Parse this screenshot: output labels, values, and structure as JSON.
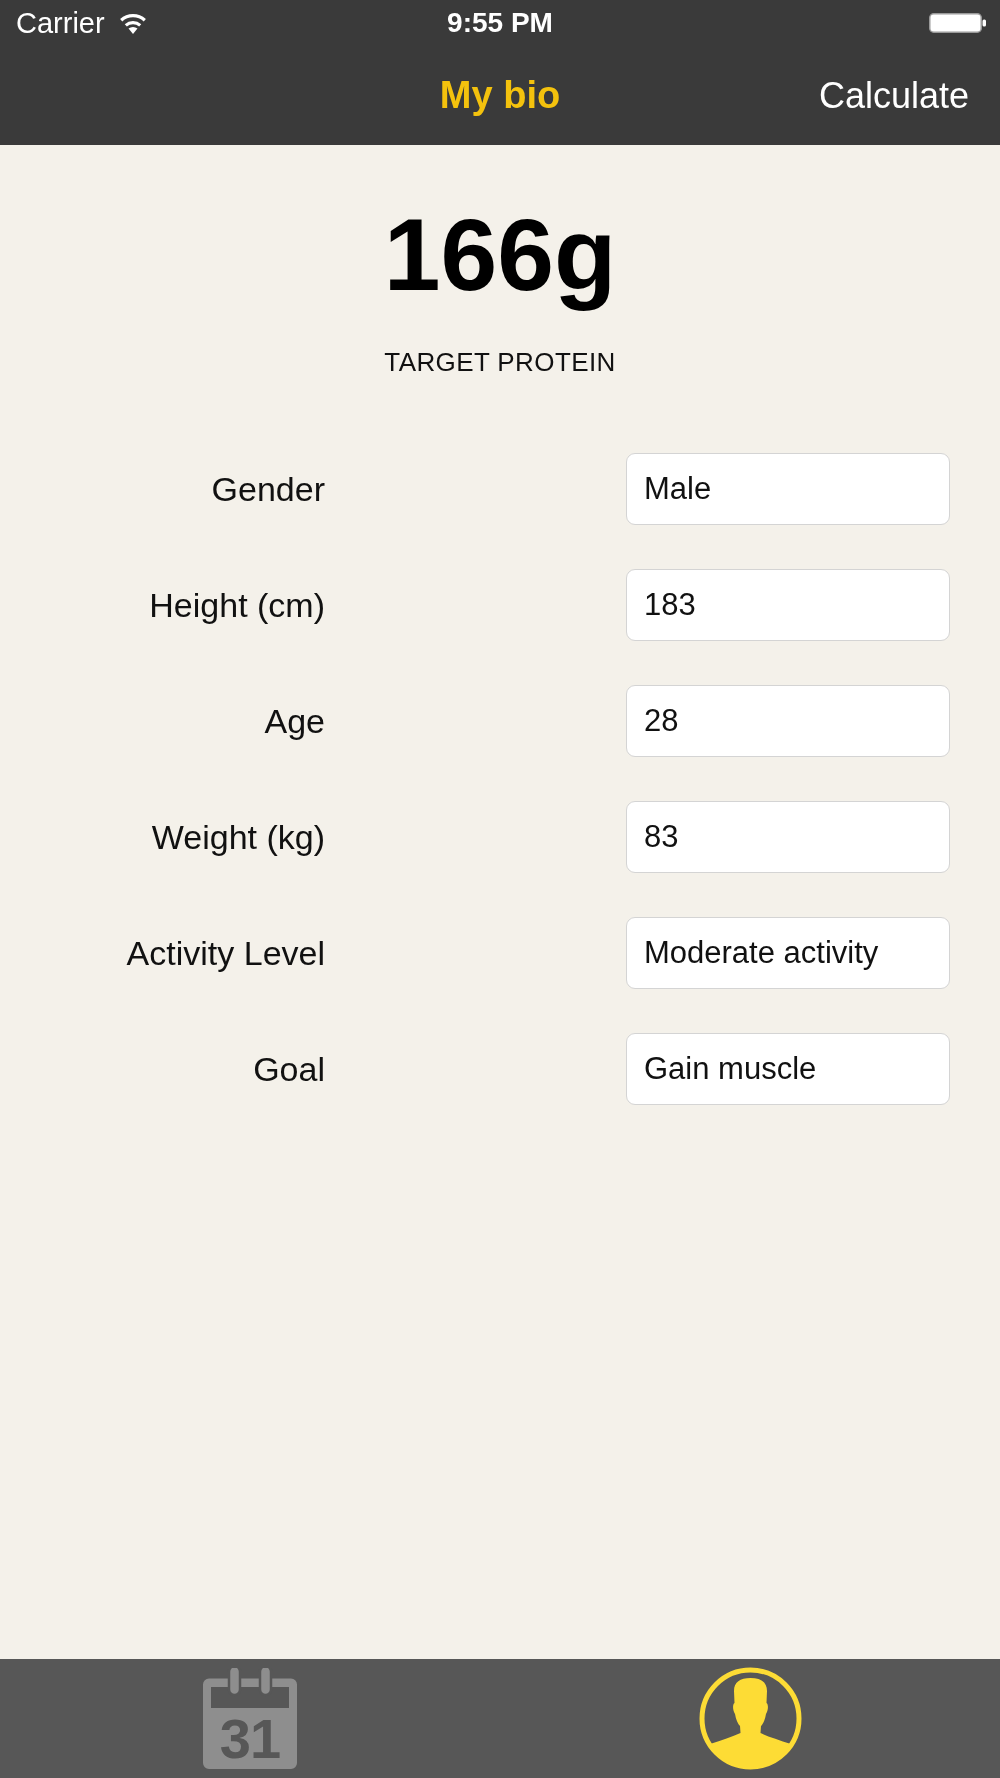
{
  "status_bar": {
    "carrier": "Carrier",
    "time": "9:55 PM"
  },
  "nav_bar": {
    "title": "My bio",
    "action": "Calculate"
  },
  "result": {
    "value": "166g",
    "label": "TARGET PROTEIN"
  },
  "fields": [
    {
      "label": "Gender",
      "value": "Male"
    },
    {
      "label": "Height (cm)",
      "value": "183"
    },
    {
      "label": "Age",
      "value": "28"
    },
    {
      "label": "Weight (kg)",
      "value": "83"
    },
    {
      "label": "Activity Level",
      "value": "Moderate activity"
    },
    {
      "label": "Goal",
      "value": "Gain muscle"
    }
  ],
  "tab_bar": {
    "tabs": [
      {
        "kind": "calendar",
        "day": "31",
        "selected": false
      },
      {
        "kind": "profile",
        "selected": true
      }
    ]
  }
}
